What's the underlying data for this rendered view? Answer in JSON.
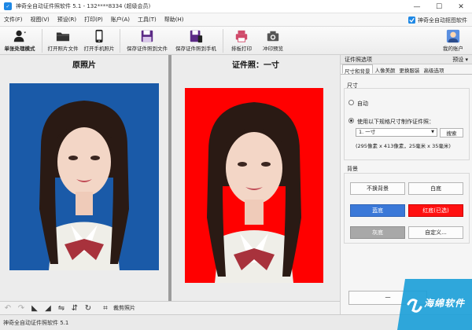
{
  "window": {
    "title": "神奇全自动证件照软件 5.1 - 132****8334 (超级会员)",
    "controls": [
      "—",
      "☐",
      "✕"
    ]
  },
  "menu": {
    "items": [
      "文件(F)",
      "视图(V)",
      "预设(R)",
      "打印(P)",
      "账户(A)",
      "工具(T)",
      "帮助(H)"
    ],
    "right_label": "神奇全自动抠图软件"
  },
  "toolbar": {
    "mode_label": "单张处理模式",
    "buttons": [
      "打开照片文件",
      "打开手机照片",
      "保存证件照到文件",
      "保存证件照到手机",
      "排板打印",
      "冲印预览"
    ],
    "account_label": "我的账户"
  },
  "panes": {
    "original_title": "原照片",
    "result_title": "证件照：一寸"
  },
  "colors": {
    "original_bg": "#1a5aa8",
    "result_bg": "#ff0000",
    "red_btn": "#ff1010",
    "blue_btn": "#3a78d8",
    "gray_btn": "#a8a8a8"
  },
  "panel": {
    "header": "证件照选项",
    "preset": "预设 ▾",
    "tabs": [
      "尺寸和背景",
      "人像美颜",
      "更换服装",
      "高级选项"
    ],
    "size": {
      "label": "尺寸",
      "auto": "自动",
      "use_spec": "使用以下规格尺寸制作证件照：",
      "selected": "1. 一寸",
      "search": "搜索",
      "dims": "(295像素 x 413像素，25毫米 x 35毫米)"
    },
    "background": {
      "label": "背景",
      "keep": "不换背景",
      "white": "白底",
      "blue": "蓝底",
      "red": "红底(已选)",
      "gray": "灰底",
      "custom": "自定义..."
    },
    "bottom_partial": "一"
  },
  "bottom_bar": {
    "crop_label": "裁剪照片"
  },
  "status": "神奇全自动证件照软件 5.1",
  "watermark": "海绵软件"
}
